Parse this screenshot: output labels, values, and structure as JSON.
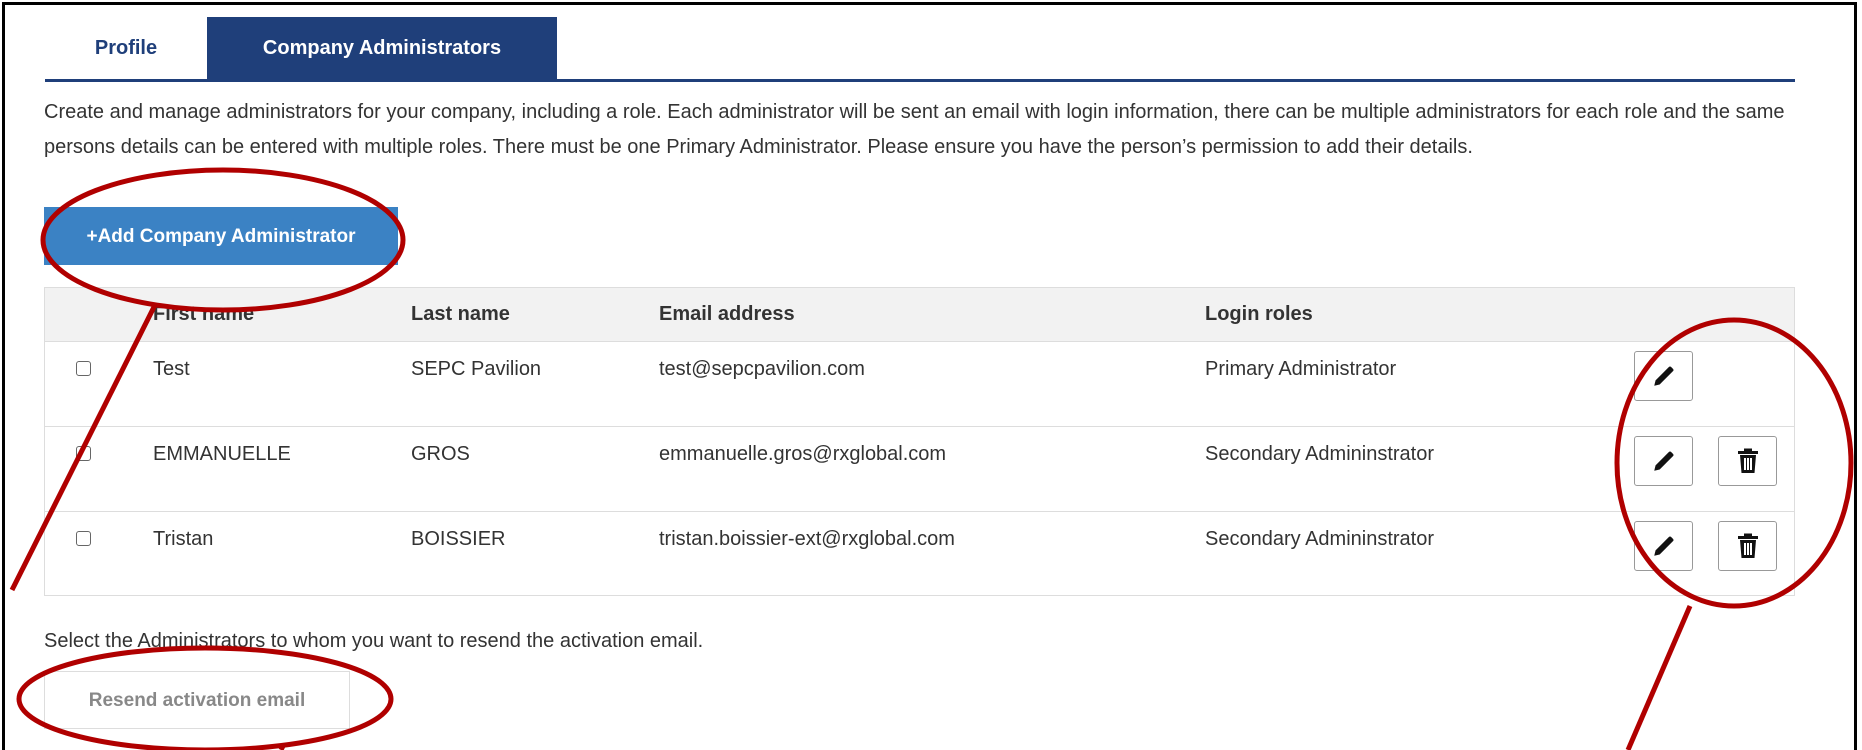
{
  "tabs": {
    "profile": "Profile",
    "company_admins": "Company Administrators"
  },
  "intro": "Create and manage administrators for your company, including a role. Each administrator will be sent an email with login information, there can be multiple administrators for each role and the same persons details can be entered with multiple roles. There must be one Primary Administrator. Please ensure you have the person’s permission to add their details.",
  "add_button": "+Add Company Administrator",
  "table": {
    "headers": {
      "first_name": "First name",
      "last_name": "Last name",
      "email": "Email address",
      "roles": "Login roles"
    },
    "rows": [
      {
        "first_name": "Test",
        "last_name": "SEPC Pavilion",
        "email": "test@sepcpavilion.com",
        "role": "Primary Administrator"
      },
      {
        "first_name": "EMMANUELLE",
        "last_name": "GROS",
        "email": "emmanuelle.gros@rxglobal.com",
        "role": "Secondary Admininstrator"
      },
      {
        "first_name": "Tristan",
        "last_name": "BOISSIER",
        "email": "tristan.boissier-ext@rxglobal.com",
        "role": "Secondary Admininstrator"
      }
    ]
  },
  "resend_note": "Select the Administrators to whom you want to resend the activation email.",
  "resend_button": "Resend activation email",
  "colors": {
    "primary_navy": "#1f3f7a",
    "button_blue": "#3b82c4",
    "annotation_red": "#b00000"
  },
  "icons": [
    "pencil-icon",
    "trash-icon"
  ]
}
